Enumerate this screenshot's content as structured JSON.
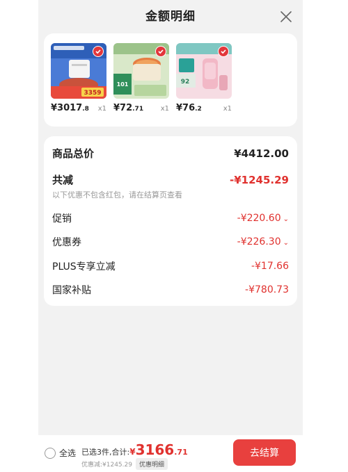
{
  "header": {
    "title": "金额明细"
  },
  "items": [
    {
      "price_int": "¥3017",
      "price_dec": ".8",
      "qty": "x1",
      "thumb_text": "3359"
    },
    {
      "price_int": "¥72",
      "price_dec": ".71",
      "qty": "x1",
      "thumb_text": "101"
    },
    {
      "price_int": "¥76",
      "price_dec": ".2",
      "qty": "x1",
      "thumb_text": "92"
    }
  ],
  "summary": {
    "total_label": "商品总价",
    "total_value": "¥4412.00",
    "reduce_label": "共减",
    "reduce_value": "-¥1245.29",
    "reduce_note": "以下优惠不包含红包，请在结算页查看",
    "promo_label": "促销",
    "promo_value": "-¥220.60",
    "coupon_label": "优惠券",
    "coupon_value": "-¥226.30",
    "plus_label": "PLUS专享立减",
    "plus_value": "-¥17.66",
    "subsidy_label": "国家补贴",
    "subsidy_value": "-¥780.73"
  },
  "bottom": {
    "select_all": "全选",
    "selected_text": "已选3件,合计:",
    "currency": "¥",
    "total_int": "3166",
    "total_dec": ".71",
    "discount_text": "优惠减:¥1245.29",
    "detail_link": "优惠明细",
    "checkout": "去结算"
  },
  "colors": {
    "accent": "#e0312e",
    "button": "#e8403e",
    "page_bg": "#f2f2f2"
  }
}
